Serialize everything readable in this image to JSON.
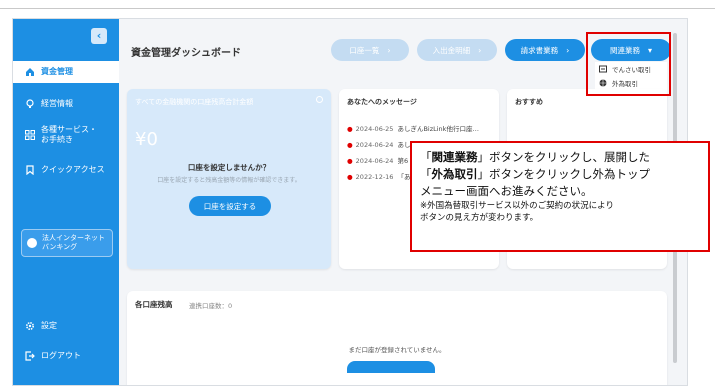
{
  "sidebar": {
    "items": [
      {
        "label": "資金管理",
        "icon": "home-icon"
      },
      {
        "label": "経営情報",
        "icon": "lightbulb-icon"
      },
      {
        "label": "各種サービス・お手続き",
        "icon": "grid-icon"
      },
      {
        "label": "クイックアクセス",
        "icon": "bookmark-icon"
      },
      {
        "label": "設定",
        "icon": "gear-icon"
      },
      {
        "label": "ログアウト",
        "icon": "logout-icon"
      }
    ],
    "netbank_label": "法人インターネットバンキング"
  },
  "header": {
    "title": "資金管理ダッシュボード",
    "buttons": {
      "account_list": "口座一覧",
      "deposit_detail": "入出金明細",
      "billing": "請求書業務",
      "related": "関連業務"
    }
  },
  "dropdown": {
    "items": [
      {
        "label": "でんさい取引",
        "icon": "densai-icon"
      },
      {
        "label": "外為取引",
        "icon": "globe-icon"
      }
    ]
  },
  "cards": {
    "total": {
      "title": "すべての金融機関の口座残高合計金額",
      "amount": "¥0",
      "question": "口座を設定しませんか？",
      "desc": "口座を設定すると残高金額等の情報が確認できます。",
      "button": "口座を設定する"
    },
    "messages": {
      "title": "あなたへのメッセージ",
      "items": [
        {
          "date": "2024-06-25",
          "text": "あしぎんBizLink他行口座…"
        },
        {
          "date": "2024-06-24",
          "text": "あしぎん"
        },
        {
          "date": "2024-06-24",
          "text": "第6"
        },
        {
          "date": "2022-12-16",
          "text": "「あ"
        }
      ]
    },
    "recommend": {
      "title": "おすすめ"
    },
    "balance": {
      "title": "各口座残高",
      "count": "連携口座数：0",
      "empty": "まだ口座が登録されていません。"
    }
  },
  "annotation": {
    "line1_pre": "「",
    "line1_bold": "関連業務",
    "line1_post": "」ボタンをクリックし、展開した",
    "line2_pre": "「",
    "line2_bold": "外為取引",
    "line2_post": "」ボタンをクリックし外為トップ",
    "line3": "メニュー画面へお進みください。",
    "note1": "※外国為替取引サービス以外のご契約の状況により",
    "note2": "ボタンの見え方が変わります。"
  },
  "colors": {
    "accent": "#1d8fe3",
    "highlight": "#e00000"
  }
}
